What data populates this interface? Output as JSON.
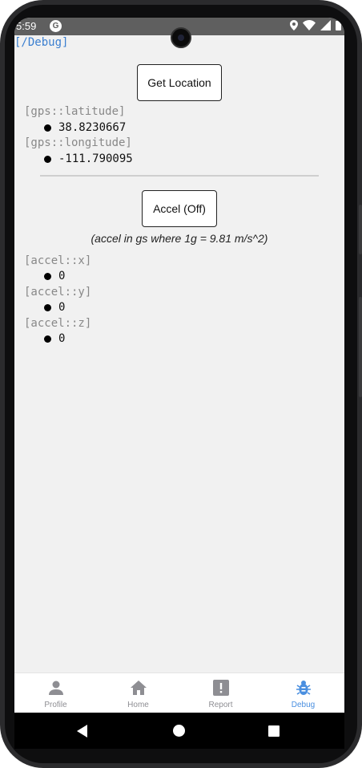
{
  "status": {
    "time": "5:59",
    "g_badge": "G"
  },
  "route_label": "[/Debug]",
  "gps": {
    "button_label": "Get Location",
    "latitude_key": "[gps::latitude]",
    "latitude_value": "38.8230667",
    "longitude_key": "[gps::longitude]",
    "longitude_value": "-111.790095"
  },
  "accel": {
    "button_label": "Accel (Off)",
    "note": "(accel in gs where 1g = 9.81 m/s^2)",
    "x_key": "[accel::x]",
    "x_value": "0",
    "y_key": "[accel::y]",
    "y_value": "0",
    "z_key": "[accel::z]",
    "z_value": "0"
  },
  "tabs": [
    {
      "label": "Profile",
      "icon": "person-icon",
      "active": false
    },
    {
      "label": "Home",
      "icon": "home-icon",
      "active": false
    },
    {
      "label": "Report",
      "icon": "report-icon",
      "active": false
    },
    {
      "label": "Debug",
      "icon": "bug-icon",
      "active": true
    }
  ],
  "colors": {
    "accent": "#4a8fe0",
    "route": "#3b7fd0",
    "inactive_tab": "#8e8e93"
  }
}
